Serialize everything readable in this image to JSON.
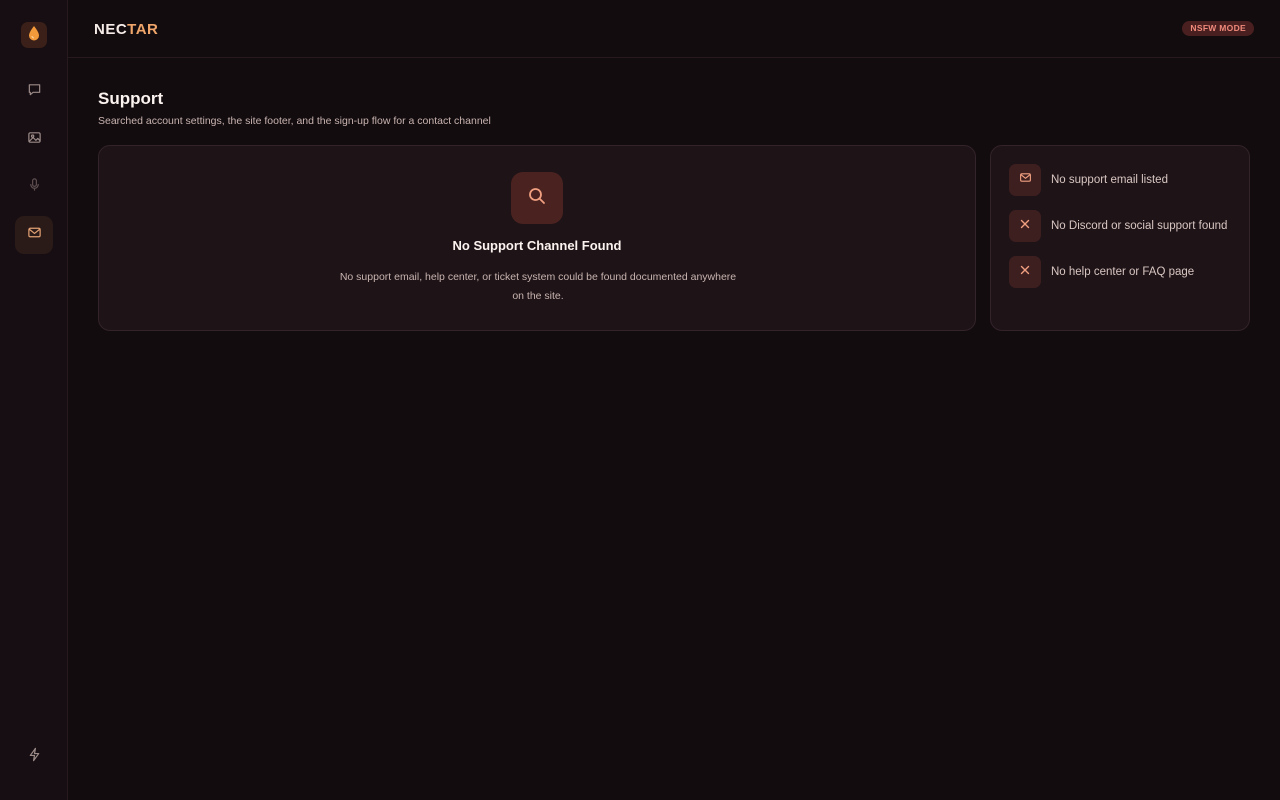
{
  "brand": {
    "part1": "NEC",
    "part2": "TAR"
  },
  "header": {
    "mode_badge": "NSFW MODE"
  },
  "sidebar": {
    "items": [
      {
        "icon": "chat-icon",
        "active": false
      },
      {
        "icon": "image-icon",
        "active": false
      },
      {
        "icon": "microphone-icon",
        "active": false
      },
      {
        "icon": "mail-icon",
        "active": true
      }
    ],
    "bottom_icon": "lightning-icon"
  },
  "page": {
    "title": "Support",
    "subtitle": "Searched account settings, the site footer, and the sign-up flow for a contact channel"
  },
  "empty_state": {
    "icon": "search-icon",
    "title": "No Support Channel Found",
    "description": "No support email, help center, or ticket system could be found documented anywhere on the site."
  },
  "checklist": [
    {
      "icon": "mail-icon",
      "label": "No support email listed"
    },
    {
      "icon": "x-icon",
      "label": "No Discord or social support found"
    },
    {
      "icon": "x-icon",
      "label": "No help center or FAQ page"
    }
  ],
  "colors": {
    "background": "#130c0f",
    "accent": "#f0a66a",
    "badge": "#f08a7c",
    "card": "#1e1317"
  }
}
